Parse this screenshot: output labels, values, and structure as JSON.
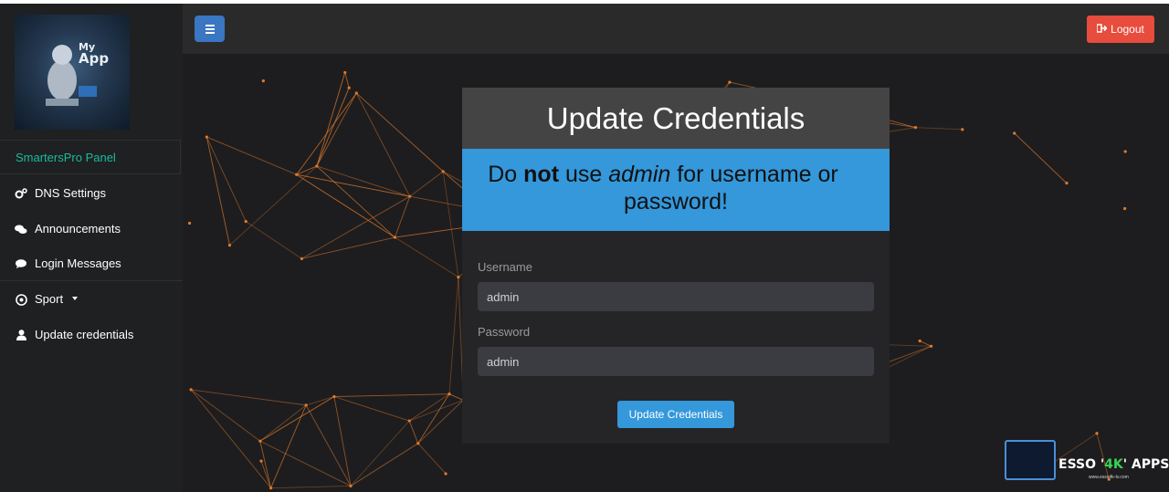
{
  "sidebar": {
    "logo_text_top": "My",
    "logo_text_main": "App",
    "panel_title": "SmartersPro Panel",
    "items": [
      {
        "label": "DNS Settings",
        "icon": "cogs-icon"
      },
      {
        "label": "Announcements",
        "icon": "comments-icon"
      },
      {
        "label": "Login Messages",
        "icon": "comment-icon"
      },
      {
        "label": "Sport",
        "icon": "soccer-ball-icon",
        "dropdown": true
      },
      {
        "label": "Update credentials",
        "icon": "user-icon"
      }
    ]
  },
  "topbar": {
    "menu_icon": "hamburger-icon",
    "logout_label": "Logout",
    "logout_icon": "sign-out-icon"
  },
  "form": {
    "title": "Update Credentials",
    "warning_prefix": "Do ",
    "warning_bold": "not",
    "warning_mid": " use ",
    "warning_italic": "admin",
    "warning_suffix": " for username or",
    "warning_line2": "password!",
    "username_label": "Username",
    "username_value": "admin",
    "password_label": "Password",
    "password_value": "admin",
    "submit_label": "Update Credentials"
  },
  "watermark": {
    "brand_prefix": "ESSO '",
    "brand_highlight": "4K",
    "brand_suffix": "' APPS",
    "url": "www.esso4k-tv.com"
  },
  "colors": {
    "accent_green": "#18bc9c",
    "primary_blue": "#3498db",
    "danger_red": "#e74c3c",
    "network_orange": "#e07a2c"
  }
}
